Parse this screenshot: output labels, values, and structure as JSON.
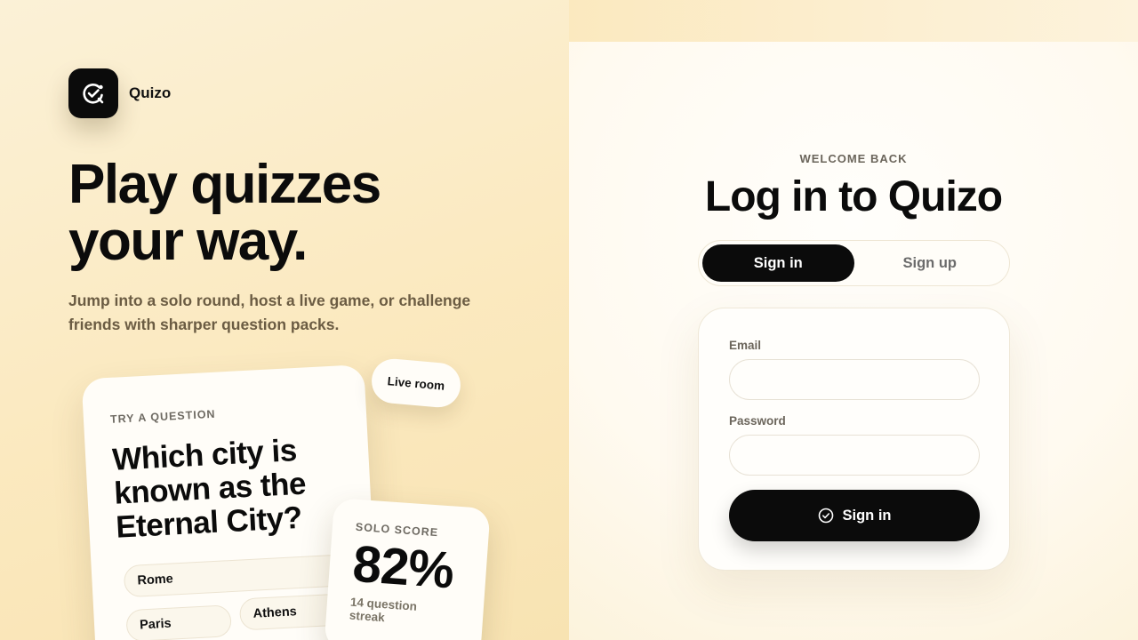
{
  "brand": {
    "name": "Quizo",
    "logo_icon": "quiz-check-icon"
  },
  "hero": {
    "headline_line1": "Play quizzes",
    "headline_line2": "your way.",
    "subtext": "Jump into a solo round, host a live game, or challenge friends with sharper question packs."
  },
  "question_card": {
    "kicker": "TRY A QUESTION",
    "question": "Which city is known as the Eternal City?",
    "choices": [
      "Rome",
      "Paris",
      "Athens"
    ]
  },
  "live_pill": {
    "label": "Live room"
  },
  "score_card": {
    "kicker": "SOLO SCORE",
    "value": "82%",
    "streak": "14 question streak"
  },
  "auth": {
    "kicker": "WELCOME BACK",
    "title": "Log in to Quizo",
    "tabs": [
      {
        "label": "Sign in",
        "active": true
      },
      {
        "label": "Sign up",
        "active": false
      }
    ],
    "email_label": "Email",
    "email_value": "",
    "password_label": "Password",
    "password_value": "",
    "submit_label": "Sign in",
    "submit_icon": "check-circle-icon"
  },
  "colors": {
    "accent": "#0b0b0b",
    "background_warm": "#fbe9bf",
    "card": "#fffdf8",
    "muted_text": "#6b655b"
  }
}
